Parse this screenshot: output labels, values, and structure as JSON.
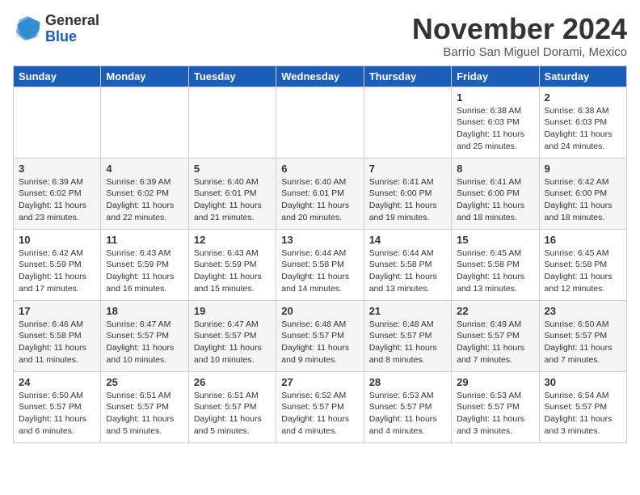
{
  "header": {
    "logo": {
      "general": "General",
      "blue": "Blue"
    },
    "month": "November 2024",
    "location": "Barrio San Miguel Dorami, Mexico"
  },
  "days_of_week": [
    "Sunday",
    "Monday",
    "Tuesday",
    "Wednesday",
    "Thursday",
    "Friday",
    "Saturday"
  ],
  "weeks": [
    [
      {
        "day": "",
        "info": ""
      },
      {
        "day": "",
        "info": ""
      },
      {
        "day": "",
        "info": ""
      },
      {
        "day": "",
        "info": ""
      },
      {
        "day": "",
        "info": ""
      },
      {
        "day": "1",
        "info": "Sunrise: 6:38 AM\nSunset: 6:03 PM\nDaylight: 11 hours and 25 minutes."
      },
      {
        "day": "2",
        "info": "Sunrise: 6:38 AM\nSunset: 6:03 PM\nDaylight: 11 hours and 24 minutes."
      }
    ],
    [
      {
        "day": "3",
        "info": "Sunrise: 6:39 AM\nSunset: 6:02 PM\nDaylight: 11 hours and 23 minutes."
      },
      {
        "day": "4",
        "info": "Sunrise: 6:39 AM\nSunset: 6:02 PM\nDaylight: 11 hours and 22 minutes."
      },
      {
        "day": "5",
        "info": "Sunrise: 6:40 AM\nSunset: 6:01 PM\nDaylight: 11 hours and 21 minutes."
      },
      {
        "day": "6",
        "info": "Sunrise: 6:40 AM\nSunset: 6:01 PM\nDaylight: 11 hours and 20 minutes."
      },
      {
        "day": "7",
        "info": "Sunrise: 6:41 AM\nSunset: 6:00 PM\nDaylight: 11 hours and 19 minutes."
      },
      {
        "day": "8",
        "info": "Sunrise: 6:41 AM\nSunset: 6:00 PM\nDaylight: 11 hours and 18 minutes."
      },
      {
        "day": "9",
        "info": "Sunrise: 6:42 AM\nSunset: 6:00 PM\nDaylight: 11 hours and 18 minutes."
      }
    ],
    [
      {
        "day": "10",
        "info": "Sunrise: 6:42 AM\nSunset: 5:59 PM\nDaylight: 11 hours and 17 minutes."
      },
      {
        "day": "11",
        "info": "Sunrise: 6:43 AM\nSunset: 5:59 PM\nDaylight: 11 hours and 16 minutes."
      },
      {
        "day": "12",
        "info": "Sunrise: 6:43 AM\nSunset: 5:59 PM\nDaylight: 11 hours and 15 minutes."
      },
      {
        "day": "13",
        "info": "Sunrise: 6:44 AM\nSunset: 5:58 PM\nDaylight: 11 hours and 14 minutes."
      },
      {
        "day": "14",
        "info": "Sunrise: 6:44 AM\nSunset: 5:58 PM\nDaylight: 11 hours and 13 minutes."
      },
      {
        "day": "15",
        "info": "Sunrise: 6:45 AM\nSunset: 5:58 PM\nDaylight: 11 hours and 13 minutes."
      },
      {
        "day": "16",
        "info": "Sunrise: 6:45 AM\nSunset: 5:58 PM\nDaylight: 11 hours and 12 minutes."
      }
    ],
    [
      {
        "day": "17",
        "info": "Sunrise: 6:46 AM\nSunset: 5:58 PM\nDaylight: 11 hours and 11 minutes."
      },
      {
        "day": "18",
        "info": "Sunrise: 6:47 AM\nSunset: 5:57 PM\nDaylight: 11 hours and 10 minutes."
      },
      {
        "day": "19",
        "info": "Sunrise: 6:47 AM\nSunset: 5:57 PM\nDaylight: 11 hours and 10 minutes."
      },
      {
        "day": "20",
        "info": "Sunrise: 6:48 AM\nSunset: 5:57 PM\nDaylight: 11 hours and 9 minutes."
      },
      {
        "day": "21",
        "info": "Sunrise: 6:48 AM\nSunset: 5:57 PM\nDaylight: 11 hours and 8 minutes."
      },
      {
        "day": "22",
        "info": "Sunrise: 6:49 AM\nSunset: 5:57 PM\nDaylight: 11 hours and 7 minutes."
      },
      {
        "day": "23",
        "info": "Sunrise: 6:50 AM\nSunset: 5:57 PM\nDaylight: 11 hours and 7 minutes."
      }
    ],
    [
      {
        "day": "24",
        "info": "Sunrise: 6:50 AM\nSunset: 5:57 PM\nDaylight: 11 hours and 6 minutes."
      },
      {
        "day": "25",
        "info": "Sunrise: 6:51 AM\nSunset: 5:57 PM\nDaylight: 11 hours and 5 minutes."
      },
      {
        "day": "26",
        "info": "Sunrise: 6:51 AM\nSunset: 5:57 PM\nDaylight: 11 hours and 5 minutes."
      },
      {
        "day": "27",
        "info": "Sunrise: 6:52 AM\nSunset: 5:57 PM\nDaylight: 11 hours and 4 minutes."
      },
      {
        "day": "28",
        "info": "Sunrise: 6:53 AM\nSunset: 5:57 PM\nDaylight: 11 hours and 4 minutes."
      },
      {
        "day": "29",
        "info": "Sunrise: 6:53 AM\nSunset: 5:57 PM\nDaylight: 11 hours and 3 minutes."
      },
      {
        "day": "30",
        "info": "Sunrise: 6:54 AM\nSunset: 5:57 PM\nDaylight: 11 hours and 3 minutes."
      }
    ]
  ]
}
